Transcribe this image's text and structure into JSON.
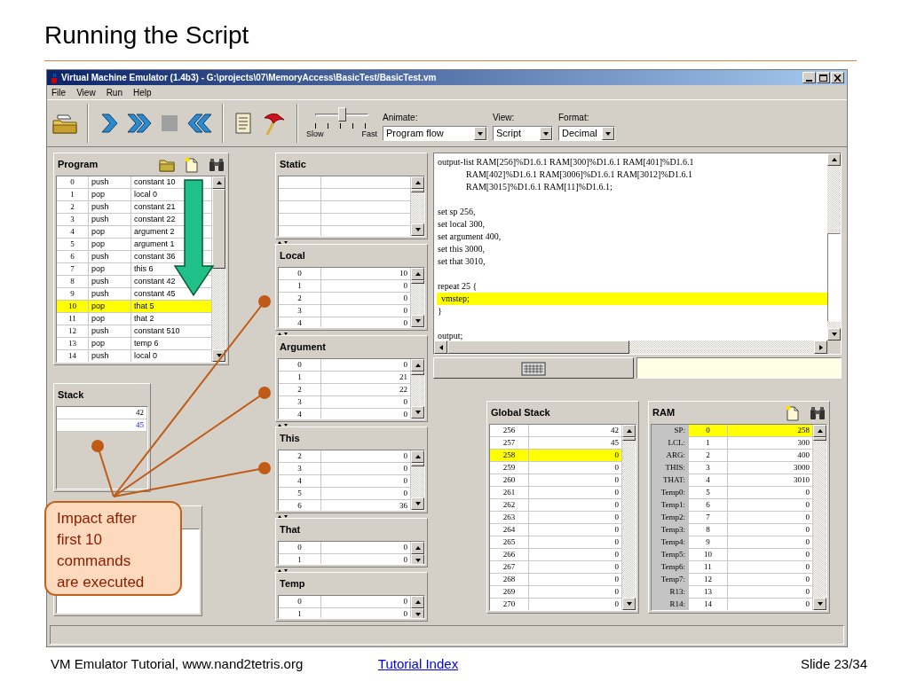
{
  "slide": {
    "title": "Running the Script",
    "footer_left": "VM Emulator Tutorial, www.nand2tetris.org",
    "footer_link": "Tutorial Index",
    "footer_right": "Slide 23/34"
  },
  "window": {
    "title": "Virtual Machine Emulator (1.4b3) - G:\\projects\\07\\MemoryAccess\\BasicTest/BasicTest.vm",
    "menu": [
      "File",
      "View",
      "Run",
      "Help"
    ]
  },
  "toolbar": {
    "speed": {
      "slow_label": "Slow",
      "fast_label": "Fast",
      "level": 0.5
    },
    "dropdowns": [
      {
        "label": "Animate:",
        "value": "Program flow"
      },
      {
        "label": "View:",
        "value": "Script"
      },
      {
        "label": "Format:",
        "value": "Decimal"
      }
    ]
  },
  "program": {
    "title": "Program",
    "rows": [
      {
        "index": "0",
        "command": "push",
        "argument": "constant 10",
        "selected": false
      },
      {
        "index": "1",
        "command": "pop",
        "argument": "local 0",
        "selected": false
      },
      {
        "index": "2",
        "command": "push",
        "argument": "constant 21",
        "selected": false
      },
      {
        "index": "3",
        "command": "push",
        "argument": "constant 22",
        "selected": false
      },
      {
        "index": "4",
        "command": "pop",
        "argument": "argument 2",
        "selected": false
      },
      {
        "index": "5",
        "command": "pop",
        "argument": "argument 1",
        "selected": false
      },
      {
        "index": "6",
        "command": "push",
        "argument": "constant 36",
        "selected": false
      },
      {
        "index": "7",
        "command": "pop",
        "argument": "this 6",
        "selected": false
      },
      {
        "index": "8",
        "command": "push",
        "argument": "constant 42",
        "selected": false
      },
      {
        "index": "9",
        "command": "push",
        "argument": "constant 45",
        "selected": false
      },
      {
        "index": "10",
        "command": "pop",
        "argument": "that 5",
        "selected": true
      },
      {
        "index": "11",
        "command": "pop",
        "argument": "that 2",
        "selected": false
      },
      {
        "index": "12",
        "command": "push",
        "argument": "constant 510",
        "selected": false
      },
      {
        "index": "13",
        "command": "pop",
        "argument": "temp 6",
        "selected": false
      },
      {
        "index": "14",
        "command": "push",
        "argument": "local 0",
        "selected": false
      }
    ]
  },
  "stack": {
    "title": "Stack",
    "values": [
      {
        "value": "42",
        "kind": "plain"
      },
      {
        "value": "45",
        "kind": "recent"
      }
    ]
  },
  "segments": [
    {
      "title": "Static"
    },
    {
      "title": "Local",
      "rows": [
        {
          "index": "0",
          "value": "10"
        },
        {
          "index": "1",
          "value": "0"
        },
        {
          "index": "2",
          "value": "0"
        },
        {
          "index": "3",
          "value": "0"
        },
        {
          "index": "4",
          "value": "0"
        }
      ]
    },
    {
      "title": "Argument",
      "rows": [
        {
          "index": "0",
          "value": "0"
        },
        {
          "index": "1",
          "value": "21"
        },
        {
          "index": "2",
          "value": "22"
        },
        {
          "index": "3",
          "value": "0"
        },
        {
          "index": "4",
          "value": "0"
        }
      ]
    },
    {
      "title": "This",
      "rows": [
        {
          "index": "2",
          "value": "0"
        },
        {
          "index": "3",
          "value": "0"
        },
        {
          "index": "4",
          "value": "0"
        },
        {
          "index": "5",
          "value": "0"
        },
        {
          "index": "6",
          "value": "36"
        }
      ]
    },
    {
      "title": "That",
      "rows": [
        {
          "index": "0",
          "value": "0"
        },
        {
          "index": "1",
          "value": "0"
        }
      ]
    },
    {
      "title": "Temp",
      "rows": [
        {
          "index": "0",
          "value": "0"
        },
        {
          "index": "1",
          "value": "0"
        }
      ]
    }
  ],
  "script": {
    "blocks": [
      {
        "lines": [
          {
            "text": "output-list RAM[256]%D1.6.1 RAM[300]%D1.6.1 RAM[401]%D1.6.1",
            "continued": [
              "RAM[402]%D1.6.1 RAM[3006]%D1.6.1 RAM[3012]%D1.6.1",
              "RAM[3015]%D1.6.1 RAM[11]%D1.6.1;"
            ],
            "selected": false
          }
        ]
      },
      {
        "lines": [
          {
            "text": "set sp 256,",
            "selected": false
          },
          {
            "text": "set local 300,",
            "selected": false
          },
          {
            "text": "set argument 400,",
            "selected": false
          },
          {
            "text": "set this 3000,",
            "selected": false
          },
          {
            "text": "set that 3010,",
            "selected": false
          }
        ]
      },
      {
        "lines": [
          {
            "text": "repeat 25 {",
            "selected": false
          },
          {
            "text": "vmstep;",
            "selected": true
          },
          {
            "text": "}",
            "selected": false
          }
        ]
      },
      {
        "lines": [
          {
            "text": "output;",
            "selected": false
          }
        ]
      }
    ]
  },
  "global_stack": {
    "title": "Global Stack",
    "rows": [
      {
        "address": "256",
        "value": "42",
        "selected": false
      },
      {
        "address": "257",
        "value": "45",
        "selected": false
      },
      {
        "address": "258",
        "value": "0",
        "selected": true
      },
      {
        "address": "259",
        "value": "0",
        "selected": false
      },
      {
        "address": "260",
        "value": "0",
        "selected": false
      },
      {
        "address": "261",
        "value": "0",
        "selected": false
      },
      {
        "address": "262",
        "value": "0",
        "selected": false
      },
      {
        "address": "263",
        "value": "0",
        "selected": false
      },
      {
        "address": "264",
        "value": "0",
        "selected": false
      },
      {
        "address": "265",
        "value": "0",
        "selected": false
      },
      {
        "address": "266",
        "value": "0",
        "selected": false
      },
      {
        "address": "267",
        "value": "0",
        "selected": false
      },
      {
        "address": "268",
        "value": "0",
        "selected": false
      },
      {
        "address": "269",
        "value": "0",
        "selected": false
      },
      {
        "address": "270",
        "value": "0",
        "selected": false
      }
    ]
  },
  "ram": {
    "title": "RAM",
    "rows": [
      {
        "label": "SP:",
        "address": "0",
        "value": "258",
        "selected": true
      },
      {
        "label": "LCL:",
        "address": "1",
        "value": "300",
        "selected": false
      },
      {
        "label": "ARG:",
        "address": "2",
        "value": "400",
        "selected": false
      },
      {
        "label": "THIS:",
        "address": "3",
        "value": "3000",
        "selected": false
      },
      {
        "label": "THAT:",
        "address": "4",
        "value": "3010",
        "selected": false
      },
      {
        "label": "Temp0:",
        "address": "5",
        "value": "0",
        "selected": false
      },
      {
        "label": "Temp1:",
        "address": "6",
        "value": "0",
        "selected": false
      },
      {
        "label": "Temp2:",
        "address": "7",
        "value": "0",
        "selected": false
      },
      {
        "label": "Temp3:",
        "address": "8",
        "value": "0",
        "selected": false
      },
      {
        "label": "Temp4:",
        "address": "9",
        "value": "0",
        "selected": false
      },
      {
        "label": "Temp5:",
        "address": "10",
        "value": "0",
        "selected": false
      },
      {
        "label": "Temp6:",
        "address": "11",
        "value": "0",
        "selected": false
      },
      {
        "label": "Temp7:",
        "address": "12",
        "value": "0",
        "selected": false
      },
      {
        "label": "R13:",
        "address": "13",
        "value": "0",
        "selected": false
      },
      {
        "label": "R14:",
        "address": "14",
        "value": "0",
        "selected": false
      }
    ]
  },
  "callout": {
    "text": "Impact after first 10 commands are executed"
  }
}
